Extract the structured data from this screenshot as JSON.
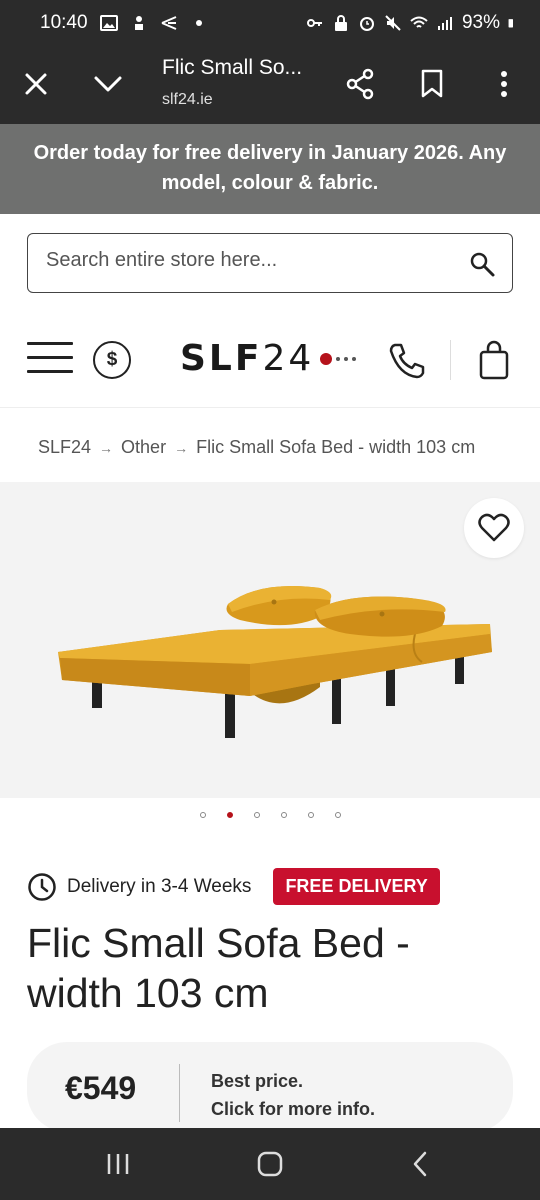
{
  "status_bar": {
    "time": "10:40",
    "battery": "93%",
    "left_icons": [
      "gallery-icon",
      "app-icon",
      "bird-icon",
      "dot-icon"
    ],
    "right_icons": [
      "key-icon",
      "lock-icon",
      "alarm-icon",
      "mute-icon",
      "wifi-icon",
      "signal-icon",
      "battery-icon"
    ]
  },
  "browser": {
    "title": "Flic Small So...",
    "url": "slf24.ie"
  },
  "promo": {
    "text": "Order today for free delivery in January 2026. Any model, colour & fabric."
  },
  "search": {
    "placeholder": "Search entire store here..."
  },
  "header": {
    "logo_bold": "SLF",
    "logo_light": "24",
    "dollar_symbol": "$"
  },
  "breadcrumb": {
    "items": [
      "SLF24",
      "Other",
      "Flic Small Sofa Bed - width 103 cm"
    ],
    "separator": "→"
  },
  "gallery": {
    "dot_count": 6,
    "active_index": 1
  },
  "product": {
    "delivery": "Delivery in 3-4 Weeks",
    "badge": "FREE DELIVERY",
    "title": "Flic Small Sofa Bed - width 103 cm",
    "price": "€549",
    "price_info_line1": "Best price.",
    "price_info_line2": "Click for more info."
  },
  "colors": {
    "accent": "#c8102e",
    "dark_bar": "#2b2b2b",
    "promo_bg": "#6f706f",
    "sofa_yellow": "#e0a526"
  }
}
